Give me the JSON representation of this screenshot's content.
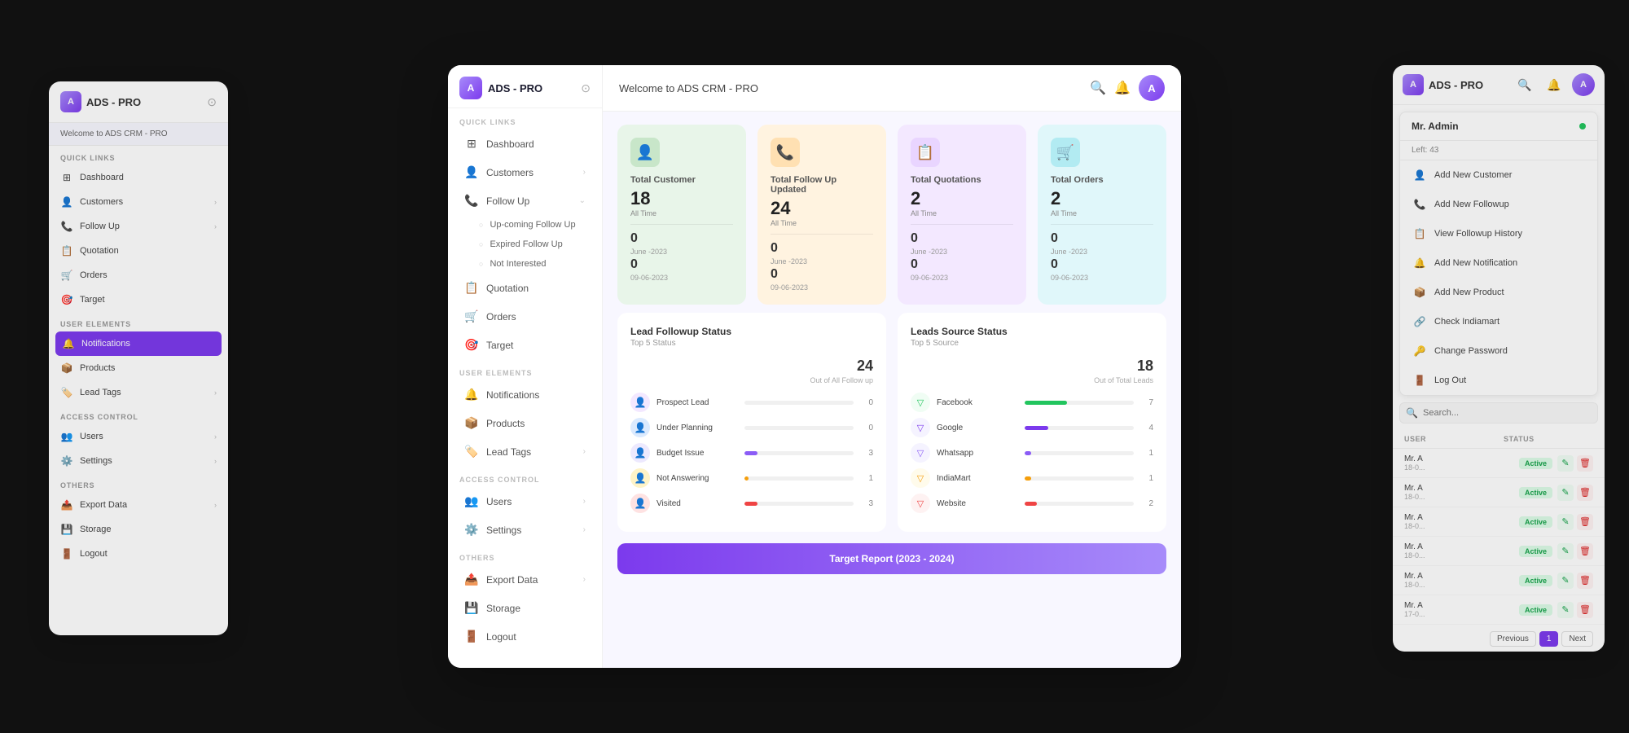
{
  "app": {
    "name": "ADS - PRO",
    "logo_letter": "A",
    "welcome": "Welcome to ADS CRM - PRO"
  },
  "sidebar": {
    "sections": [
      {
        "label": "QUICK LINKS",
        "items": [
          {
            "id": "dashboard",
            "label": "Dashboard",
            "icon": "⊞",
            "active": false
          },
          {
            "id": "customers",
            "label": "Customers",
            "icon": "👤",
            "active": false,
            "has_arrow": true
          },
          {
            "id": "followup",
            "label": "Follow Up",
            "icon": "📞",
            "active": false,
            "has_arrow": true,
            "subitems": [
              "Up-coming Follow Up",
              "Expired Follow Up",
              "Not Interested"
            ]
          },
          {
            "id": "quotation",
            "label": "Quotation",
            "icon": "📋",
            "active": false
          },
          {
            "id": "orders",
            "label": "Orders",
            "icon": "🛒",
            "active": false
          },
          {
            "id": "target",
            "label": "Target",
            "icon": "🎯",
            "active": false
          }
        ]
      },
      {
        "label": "USER ELEMENTS",
        "items": [
          {
            "id": "notifications",
            "label": "Notifications",
            "icon": "🔔",
            "active": false
          },
          {
            "id": "products",
            "label": "Products",
            "icon": "📦",
            "active": false
          },
          {
            "id": "lead-tags",
            "label": "Lead Tags",
            "icon": "🏷️",
            "active": false,
            "has_arrow": true
          }
        ]
      },
      {
        "label": "ACCESS CONTROL",
        "items": [
          {
            "id": "users",
            "label": "Users",
            "icon": "👥",
            "active": false,
            "has_arrow": true
          },
          {
            "id": "settings",
            "label": "Settings",
            "icon": "⚙️",
            "active": false,
            "has_arrow": true
          }
        ]
      },
      {
        "label": "OTHERS",
        "items": [
          {
            "id": "export",
            "label": "Export Data",
            "icon": "📤",
            "active": false,
            "has_arrow": true
          },
          {
            "id": "storage",
            "label": "Storage",
            "icon": "💾",
            "active": false
          },
          {
            "id": "logout",
            "label": "Logout",
            "icon": "🚪",
            "active": false
          }
        ]
      }
    ]
  },
  "stats": [
    {
      "id": "total-customer",
      "title": "Total Customer",
      "icon": "👤",
      "color": "green",
      "all_time": "18",
      "all_time_label": "All Time",
      "june_val": "0",
      "june_label": "June -2023",
      "sep_val": "0",
      "sep_label": "09-06-2023"
    },
    {
      "id": "total-followup",
      "title": "Total Follow Up Updated",
      "icon": "📞",
      "color": "orange",
      "all_time": "24",
      "all_time_label": "All Time",
      "june_val": "0",
      "june_label": "June -2023",
      "sep_val": "0",
      "sep_label": "09-06-2023"
    },
    {
      "id": "total-quotations",
      "title": "Total Quotations",
      "icon": "📋",
      "color": "purple",
      "all_time": "2",
      "all_time_label": "All Time",
      "june_val": "0",
      "june_label": "June -2023",
      "sep_val": "0",
      "sep_label": "09-06-2023"
    },
    {
      "id": "total-orders",
      "title": "Total Orders",
      "icon": "🛒",
      "color": "teal",
      "all_time": "2",
      "all_time_label": "All Time",
      "june_val": "0",
      "june_label": "June -2023",
      "sep_val": "0",
      "sep_label": "09-06-2023"
    }
  ],
  "lead_followup": {
    "title": "Lead Followup Status",
    "subtitle": "Top 5 Status",
    "total": "24",
    "total_label": "Out of All Follow up",
    "items": [
      {
        "label": "Prospect Lead",
        "color": "#a78bfa",
        "icon": "👤",
        "icon_bg": "#f3e8ff",
        "value": 0,
        "bar_pct": 0
      },
      {
        "label": "Under Planning",
        "color": "#60a5fa",
        "icon": "👤",
        "icon_bg": "#dbeafe",
        "value": 0,
        "bar_pct": 0
      },
      {
        "label": "Budget Issue",
        "color": "#8b5cf6",
        "icon": "👤",
        "icon_bg": "#ede9fe",
        "value": 3,
        "bar_pct": 12
      },
      {
        "label": "Not Answering",
        "color": "#f59e0b",
        "icon": "👤",
        "icon_bg": "#fef3c7",
        "value": 1,
        "bar_pct": 4
      },
      {
        "label": "Visited",
        "color": "#ef4444",
        "icon": "👤",
        "icon_bg": "#fee2e2",
        "value": 3,
        "bar_pct": 12
      }
    ]
  },
  "leads_source": {
    "title": "Leads Source Status",
    "subtitle": "Top 5 Source",
    "total": "18",
    "total_label": "Out of Total Leads",
    "items": [
      {
        "label": "Facebook",
        "color": "#22c55e",
        "icon": "▽",
        "value": 7,
        "bar_pct": 39
      },
      {
        "label": "Google",
        "color": "#7c3aed",
        "icon": "▽",
        "value": 4,
        "bar_pct": 22
      },
      {
        "label": "Whatsapp",
        "color": "#8b5cf6",
        "icon": "▽",
        "value": 1,
        "bar_pct": 6
      },
      {
        "label": "IndiaMart",
        "color": "#f59e0b",
        "icon": "▽",
        "value": 1,
        "bar_pct": 6
      },
      {
        "label": "Website",
        "color": "#ef4444",
        "icon": "▽",
        "value": 2,
        "bar_pct": 11
      }
    ]
  },
  "target_banner": "Target Report (2023 - 2024)",
  "dropdown_menu": {
    "user": "Mr. Admin",
    "left_count": "Left: 43",
    "items": [
      {
        "label": "Add New Customer",
        "icon": "👤"
      },
      {
        "label": "Add New Followup",
        "icon": "📞"
      },
      {
        "label": "View Followup History",
        "icon": "📋"
      },
      {
        "label": "Add New Notification",
        "icon": "🔔"
      },
      {
        "label": "Add New Product",
        "icon": "📦"
      },
      {
        "label": "Check Indiamart",
        "icon": "🔗"
      },
      {
        "label": "Change Password",
        "icon": "🔑"
      },
      {
        "label": "Log Out",
        "icon": "🚪"
      }
    ]
  },
  "back_left": {
    "sections": [
      {
        "label": "QUICK LINKS",
        "items": [
          "Dashboard",
          "Customers",
          "Follow Up",
          "Quotation",
          "Orders",
          "Target"
        ]
      },
      {
        "label": "USER ELEMENTS",
        "items": [
          "Notifications",
          "Products",
          "Lead Tags"
        ]
      },
      {
        "label": "ACCESS CONTROL",
        "items": [
          "Users",
          "Settings"
        ]
      },
      {
        "label": "OTHERS",
        "items": [
          "Export Data",
          "Storage",
          "Logout"
        ]
      }
    ],
    "active_item": "Notifications"
  },
  "back_right": {
    "header_title": "ADS - PRO",
    "table": {
      "columns": [
        "USER",
        "STATUS"
      ],
      "rows": [
        {
          "name": "Mr. A",
          "date": "18-0...",
          "status": "Active"
        },
        {
          "name": "Mr. A",
          "date": "18-0...",
          "status": "Active"
        },
        {
          "name": "Mr. A",
          "date": "18-0...",
          "status": "Active"
        },
        {
          "name": "Mr. A",
          "date": "18-0...",
          "status": "Active"
        },
        {
          "name": "Mr. A",
          "date": "18-0...",
          "status": "Active"
        },
        {
          "name": "Mr. A",
          "date": "17-0...",
          "status": "Active"
        }
      ]
    },
    "pagination": {
      "prev": "Previous",
      "page": "1",
      "next": "Next"
    }
  }
}
